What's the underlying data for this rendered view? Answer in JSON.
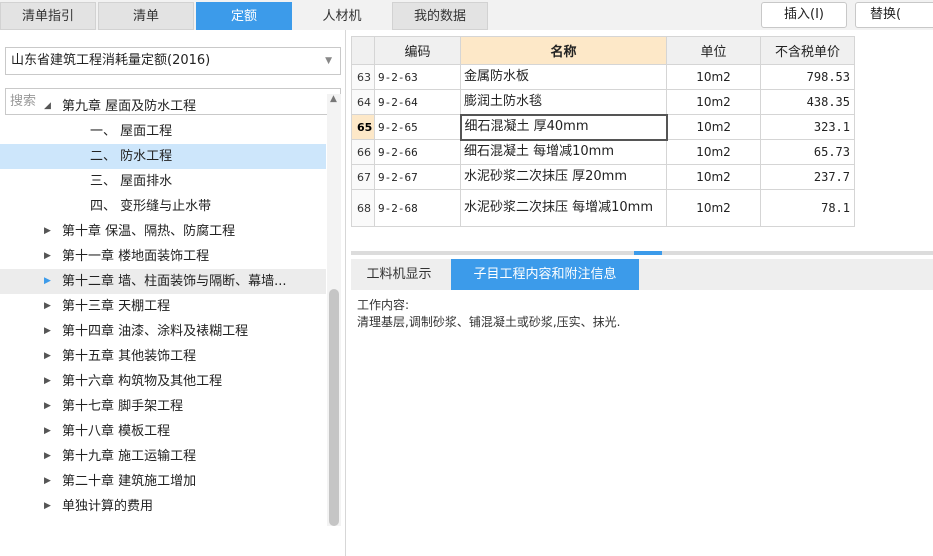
{
  "tabs": [
    "清单指引",
    "清单",
    "定额",
    "人材机",
    "我的数据"
  ],
  "actions": {
    "insert": "插入(I)",
    "replace": "替换("
  },
  "left": {
    "quota_select": "山东省建筑工程消耗量定额(2016)",
    "search_placeholder": "搜索",
    "tree": [
      "第九章 屋面及防水工程",
      "一、 屋面工程",
      "二、 防水工程",
      "三、 屋面排水",
      "四、 变形缝与止水带",
      "第十章 保温、隔热、防腐工程",
      "第十一章 楼地面装饰工程",
      "第十二章 墙、柱面装饰与隔断、幕墙...",
      "第十三章 天棚工程",
      "第十四章 油漆、涂料及裱糊工程",
      "第十五章 其他装饰工程",
      "第十六章 构筑物及其他工程",
      "第十七章 脚手架工程",
      "第十八章 模板工程",
      "第十九章 施工运输工程",
      "第二十章 建筑施工增加",
      "单独计算的费用"
    ]
  },
  "grid": {
    "headers": [
      "编码",
      "名称",
      "单位",
      "不含税单价"
    ],
    "rows": [
      {
        "no": "63",
        "code": "9-2-63",
        "name": "金属防水板",
        "unit": "10m2",
        "price": "798.53"
      },
      {
        "no": "64",
        "code": "9-2-64",
        "name": "膨润土防水毯",
        "unit": "10m2",
        "price": "438.35"
      },
      {
        "no": "65",
        "code": "9-2-65",
        "name": "细石混凝土 厚40mm",
        "unit": "10m2",
        "price": "323.1"
      },
      {
        "no": "66",
        "code": "9-2-66",
        "name": "细石混凝土 每增减10mm",
        "unit": "10m2",
        "price": "65.73"
      },
      {
        "no": "67",
        "code": "9-2-67",
        "name": "水泥砂浆二次抹压 厚20mm",
        "unit": "10m2",
        "price": "237.7"
      },
      {
        "no": "68",
        "code": "9-2-68",
        "name": "水泥砂浆二次抹压 每增减10mm",
        "unit": "10m2",
        "price": "78.1"
      }
    ]
  },
  "bottom": {
    "tabs": [
      "工料机显示",
      "子目工程内容和附注信息"
    ],
    "work_label": "工作内容:",
    "work_text": "清理基层,调制砂浆、铺混凝土或砂浆,压实、抹光."
  }
}
